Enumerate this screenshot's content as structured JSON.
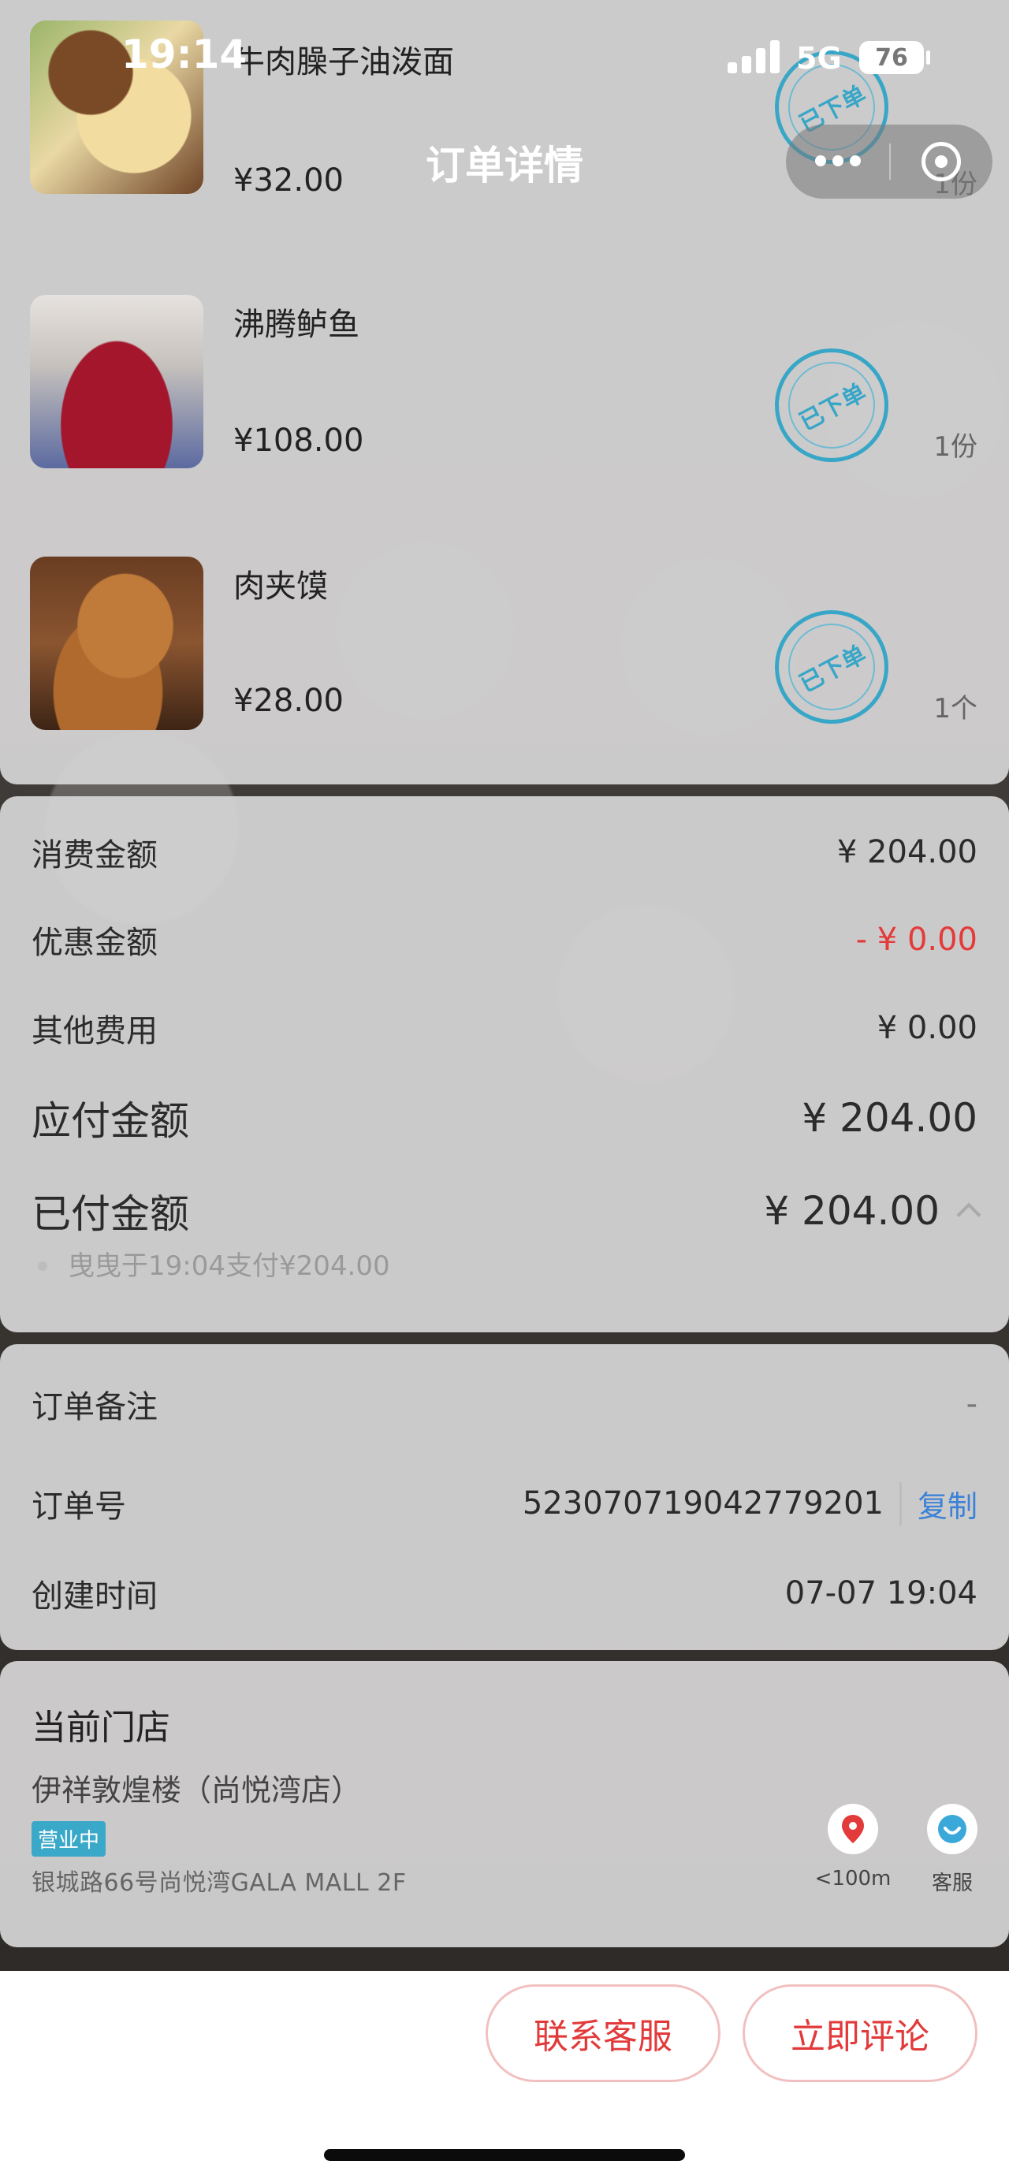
{
  "status_bar": {
    "time": "19:14",
    "network": "5G",
    "battery": "76"
  },
  "nav": {
    "title": "订单详情"
  },
  "items": [
    {
      "name": "牛肉臊子油泼面",
      "price": "¥32.00",
      "qty": "1份",
      "stamp": "已下单"
    },
    {
      "name": "沸腾鲈鱼",
      "price": "¥108.00",
      "qty": "1份",
      "stamp": "已下单"
    },
    {
      "name": "肉夹馍",
      "price": "¥28.00",
      "qty": "1个",
      "stamp": "已下单"
    }
  ],
  "summary": {
    "consume_label": "消费金额",
    "consume_value": "¥ 204.00",
    "discount_label": "优惠金额",
    "discount_value": "- ¥ 0.00",
    "other_label": "其他费用",
    "other_value": "¥ 0.00",
    "payable_label": "应付金额",
    "payable_value": "¥ 204.00",
    "paid_label": "已付金额",
    "paid_value": "¥ 204.00",
    "paid_note": "曳曳于19:04支付¥204.00"
  },
  "order": {
    "remark_label": "订单备注",
    "remark_value": "-",
    "number_label": "订单号",
    "number_value": "523070719042779201",
    "copy_label": "复制",
    "created_label": "创建时间",
    "created_value": "07-07 19:04"
  },
  "store": {
    "title": "当前门店",
    "name": "伊祥敦煌楼（尚悦湾店）",
    "status": "营业中",
    "address": "银城路66号尚悦湾GALA MALL 2F",
    "distance": "<100m",
    "service": "客服"
  },
  "actions": {
    "contact": "联系客服",
    "review": "立即评论"
  },
  "colors": {
    "accent": "#e23a3a",
    "stamp": "#37a6c7",
    "link": "#3b82d8"
  }
}
